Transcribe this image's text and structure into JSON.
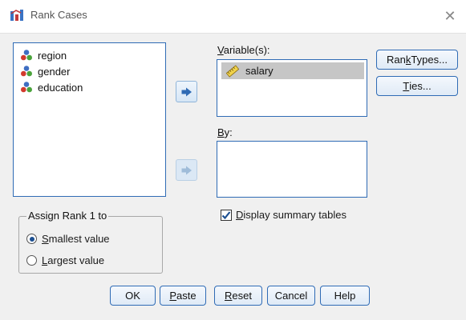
{
  "window": {
    "title": "Rank Cases",
    "close_glyph": "✕"
  },
  "source_list": {
    "items": [
      {
        "label": "region",
        "icon": "nominal-variable-icon"
      },
      {
        "label": "gender",
        "icon": "nominal-variable-icon"
      },
      {
        "label": "education",
        "icon": "nominal-variable-icon"
      }
    ]
  },
  "variables_box": {
    "label_prefix": "",
    "label_mnemonic": "V",
    "label_rest": "ariable(s):",
    "items": [
      {
        "label": "salary",
        "icon": "scale-variable-icon",
        "selected": true
      }
    ]
  },
  "by_box": {
    "label_mnemonic": "B",
    "label_rest": "y:",
    "items": []
  },
  "side_buttons": {
    "rank_types": {
      "pre": "Ran",
      "mnemonic": "k",
      "post": " Types..."
    },
    "ties": {
      "pre": "",
      "mnemonic": "T",
      "post": "ies..."
    }
  },
  "display_summary": {
    "checked": true,
    "mnemonic": "D",
    "rest": "isplay summary tables"
  },
  "assign_rank": {
    "title": "Assign Rank 1 to",
    "options": [
      {
        "mnemonic": "S",
        "rest": "mallest value",
        "checked": true
      },
      {
        "mnemonic": "L",
        "rest": "argest value",
        "checked": false
      }
    ]
  },
  "bottom_buttons": {
    "ok": "OK",
    "paste": {
      "mnemonic": "P",
      "rest": "aste"
    },
    "reset": {
      "mnemonic": "R",
      "rest": "eset"
    },
    "cancel": "Cancel",
    "help": "Help"
  },
  "colors": {
    "accent": "#2f6bb5",
    "selection": "#c6c6c6",
    "arrow": "#2f6bb5",
    "arrow_disabled": "#9fbcd9"
  }
}
